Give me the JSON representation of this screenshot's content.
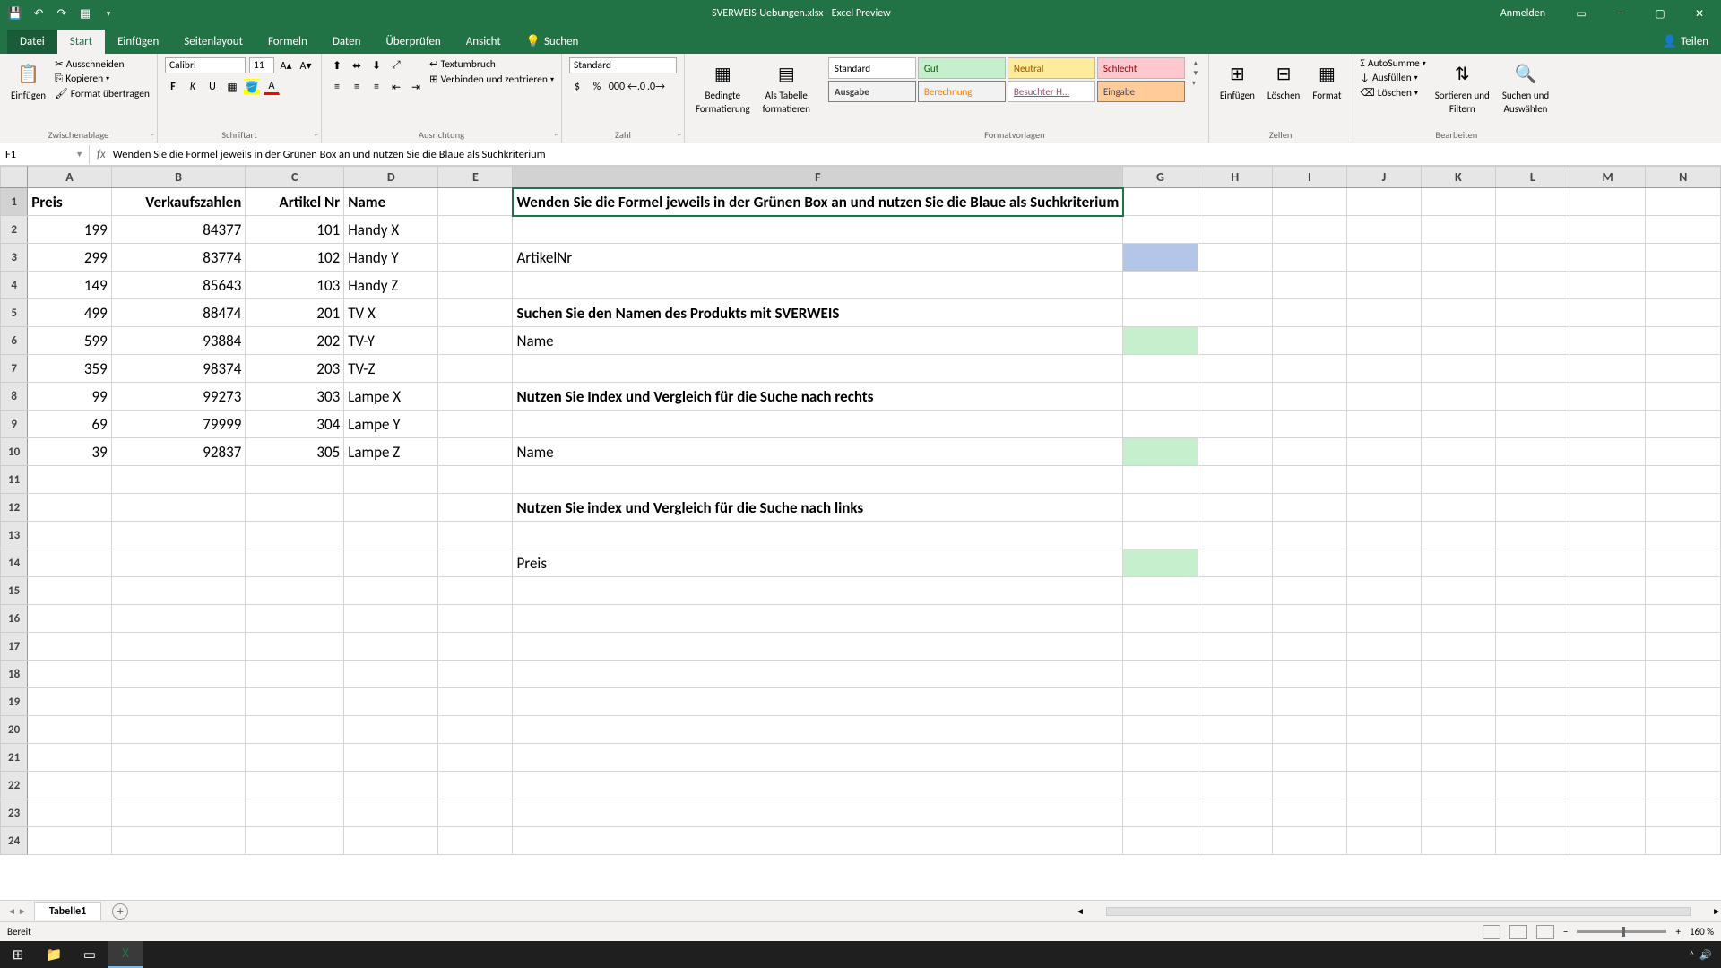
{
  "title": "SVERWEIS-Uebungen.xlsx - Excel Preview",
  "sign_in": "Anmelden",
  "share": "Teilen",
  "tabs": {
    "datei": "Datei",
    "start": "Start",
    "einfuegen": "Einfügen",
    "seitenlayout": "Seitenlayout",
    "formeln": "Formeln",
    "daten": "Daten",
    "ueberpruefen": "Überprüfen",
    "ansicht": "Ansicht",
    "suchen": "Suchen"
  },
  "ribbon": {
    "clipboard": {
      "label": "Zwischenablage",
      "paste": "Einfügen",
      "cut": "Ausschneiden",
      "copy": "Kopieren",
      "format": "Format übertragen"
    },
    "font": {
      "label": "Schriftart",
      "name": "Calibri",
      "size": "11"
    },
    "align": {
      "label": "Ausrichtung",
      "wrap": "Textumbruch",
      "merge": "Verbinden und zentrieren"
    },
    "number": {
      "label": "Zahl",
      "format": "Standard"
    },
    "cond": {
      "label1": "Bedingte",
      "label2": "Formatierung",
      "table1": "Als Tabelle",
      "table2": "formatieren"
    },
    "styles": {
      "label": "Formatvorlagen",
      "standard": "Standard",
      "gut": "Gut",
      "neutral": "Neutral",
      "schlecht": "Schlecht",
      "ausgabe": "Ausgabe",
      "berechnung": "Berechnung",
      "besucht": "Besuchter H...",
      "eingabe": "Eingabe"
    },
    "cells": {
      "label": "Zellen",
      "insert": "Einfügen",
      "delete": "Löschen",
      "format": "Format"
    },
    "edit": {
      "label": "Bearbeiten",
      "autosum": "AutoSumme",
      "fill": "Ausfüllen",
      "clear": "Löschen",
      "sort1": "Sortieren und",
      "sort2": "Filtern",
      "find1": "Suchen und",
      "find2": "Auswählen"
    }
  },
  "namebox": "F1",
  "formula": "Wenden Sie die Formel jeweils in der Grünen Box an und nutzen Sie die Blaue als Suchkriterium",
  "columns": [
    "A",
    "B",
    "C",
    "D",
    "E",
    "F",
    "G",
    "H",
    "I",
    "J",
    "K",
    "L",
    "M",
    "N"
  ],
  "headers": {
    "A": "Preis",
    "B": "Verkaufszahlen",
    "C": "Artikel Nr",
    "D": "Name"
  },
  "rows": [
    {
      "A": "199",
      "B": "84377",
      "C": "101",
      "D": "Handy X"
    },
    {
      "A": "299",
      "B": "83774",
      "C": "102",
      "D": "Handy Y"
    },
    {
      "A": "149",
      "B": "85643",
      "C": "103",
      "D": "Handy Z"
    },
    {
      "A": "499",
      "B": "88474",
      "C": "201",
      "D": "TV X"
    },
    {
      "A": "599",
      "B": "93884",
      "C": "202",
      "D": "TV-Y"
    },
    {
      "A": "359",
      "B": "98374",
      "C": "203",
      "D": "TV-Z"
    },
    {
      "A": "99",
      "B": "99273",
      "C": "303",
      "D": "Lampe X"
    },
    {
      "A": "69",
      "B": "79999",
      "C": "304",
      "D": "Lampe Y"
    },
    {
      "A": "39",
      "B": "92837",
      "C": "305",
      "D": "Lampe Z"
    }
  ],
  "instructions": {
    "F1": "Wenden Sie die Formel jeweils in der Grünen Box an und nutzen Sie die Blaue als Suchkriterium",
    "F3": "ArtikelNr",
    "F5": "Suchen Sie den Namen des Produkts mit SVERWEIS",
    "F6": "Name",
    "F8": "Nutzen Sie Index und Vergleich für die Suche nach rechts",
    "F10": "Name",
    "F12": "Nutzen Sie index und Vergleich für die Suche nach links",
    "F14": "Preis"
  },
  "sheet": "Tabelle1",
  "status": "Bereit",
  "zoom": "160 %"
}
